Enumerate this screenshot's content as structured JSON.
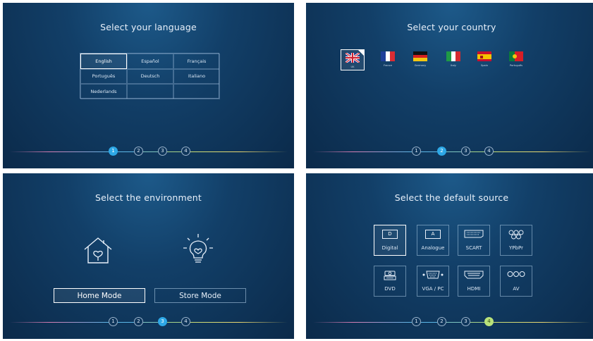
{
  "panels": {
    "language": {
      "title": "Select your language",
      "options": [
        "English",
        "Español",
        "Français",
        "Português",
        "Deutsch",
        "Italiano",
        "Nederlands",
        "",
        ""
      ],
      "selected": "English"
    },
    "country": {
      "title": "Select your country",
      "options": [
        {
          "label": "UK",
          "flag": "uk-flag-icon"
        },
        {
          "label": "France",
          "flag": "france-flag-icon"
        },
        {
          "label": "Germany",
          "flag": "germany-flag-icon"
        },
        {
          "label": "Italy",
          "flag": "italy-flag-icon"
        },
        {
          "label": "Spain",
          "flag": "spain-flag-icon"
        },
        {
          "label": "Português",
          "flag": "portugal-flag-icon"
        }
      ],
      "selected": "UK"
    },
    "environment": {
      "title": "Select the environment",
      "home_label": "Home Mode",
      "store_label": "Store Mode",
      "selected": "Home Mode"
    },
    "source": {
      "title": "Select the default source",
      "options": [
        {
          "label": "Digital",
          "icon_text": "D",
          "icon": "digital-icon"
        },
        {
          "label": "Analogue",
          "icon_text": "A",
          "icon": "analogue-icon"
        },
        {
          "label": "SCART",
          "icon": "scart-icon"
        },
        {
          "label": "YPbPr",
          "icon": "ypbpr-icon"
        },
        {
          "label": "DVD",
          "icon": "dvd-icon"
        },
        {
          "label": "VGA / PC",
          "icon": "vga-icon"
        },
        {
          "label": "HDMI",
          "icon": "hdmi-icon"
        },
        {
          "label": "AV",
          "icon": "av-icon"
        }
      ],
      "selected": "Digital"
    }
  },
  "steps": [
    "1",
    "2",
    "3",
    "4"
  ],
  "colors": {
    "accent": "#2ea8e6",
    "final_step": "#b9e27a",
    "background_top": "#1d5a8a",
    "background_bottom": "#0b2a4a"
  }
}
